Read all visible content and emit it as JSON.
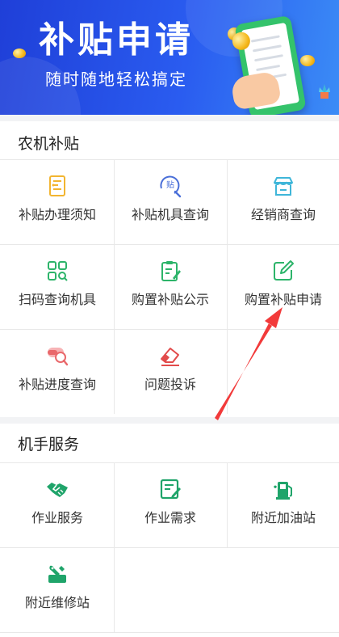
{
  "banner": {
    "title": "补贴申请",
    "subtitle": "随时随地轻松搞定"
  },
  "sections": [
    {
      "title": "农机补贴",
      "items": [
        {
          "label": "补贴办理须知",
          "icon": "document-list-icon",
          "color": "#f2b531"
        },
        {
          "label": "补贴机具查询",
          "icon": "subsidy-search-icon",
          "color": "#4a6fd8"
        },
        {
          "label": "经销商查询",
          "icon": "store-icon",
          "color": "#3fb6d9"
        },
        {
          "label": "扫码查询机具",
          "icon": "scan-grid-icon",
          "color": "#2db46a"
        },
        {
          "label": "购置补贴公示",
          "icon": "clipboard-edit-icon",
          "color": "#2db46a"
        },
        {
          "label": "购置补贴申请",
          "icon": "edit-square-icon",
          "color": "#2db46a"
        },
        {
          "label": "补贴进度查询",
          "icon": "progress-search-icon",
          "color": "#e9686b"
        },
        {
          "label": "问题投诉",
          "icon": "complaint-eraser-icon",
          "color": "#e24b4b"
        }
      ]
    },
    {
      "title": "机手服务",
      "items": [
        {
          "label": "作业服务",
          "icon": "handshake-icon",
          "color": "#1fa46a"
        },
        {
          "label": "作业需求",
          "icon": "request-form-icon",
          "color": "#1fa46a"
        },
        {
          "label": "附近加油站",
          "icon": "gas-station-icon",
          "color": "#1fa46a"
        },
        {
          "label": "附近维修站",
          "icon": "repair-wrench-icon",
          "color": "#1fa46a"
        }
      ]
    }
  ],
  "colors": {
    "banner": "#2a5cf0",
    "accent_arrow": "#f23a3a",
    "divider": "#e8e8e8"
  }
}
